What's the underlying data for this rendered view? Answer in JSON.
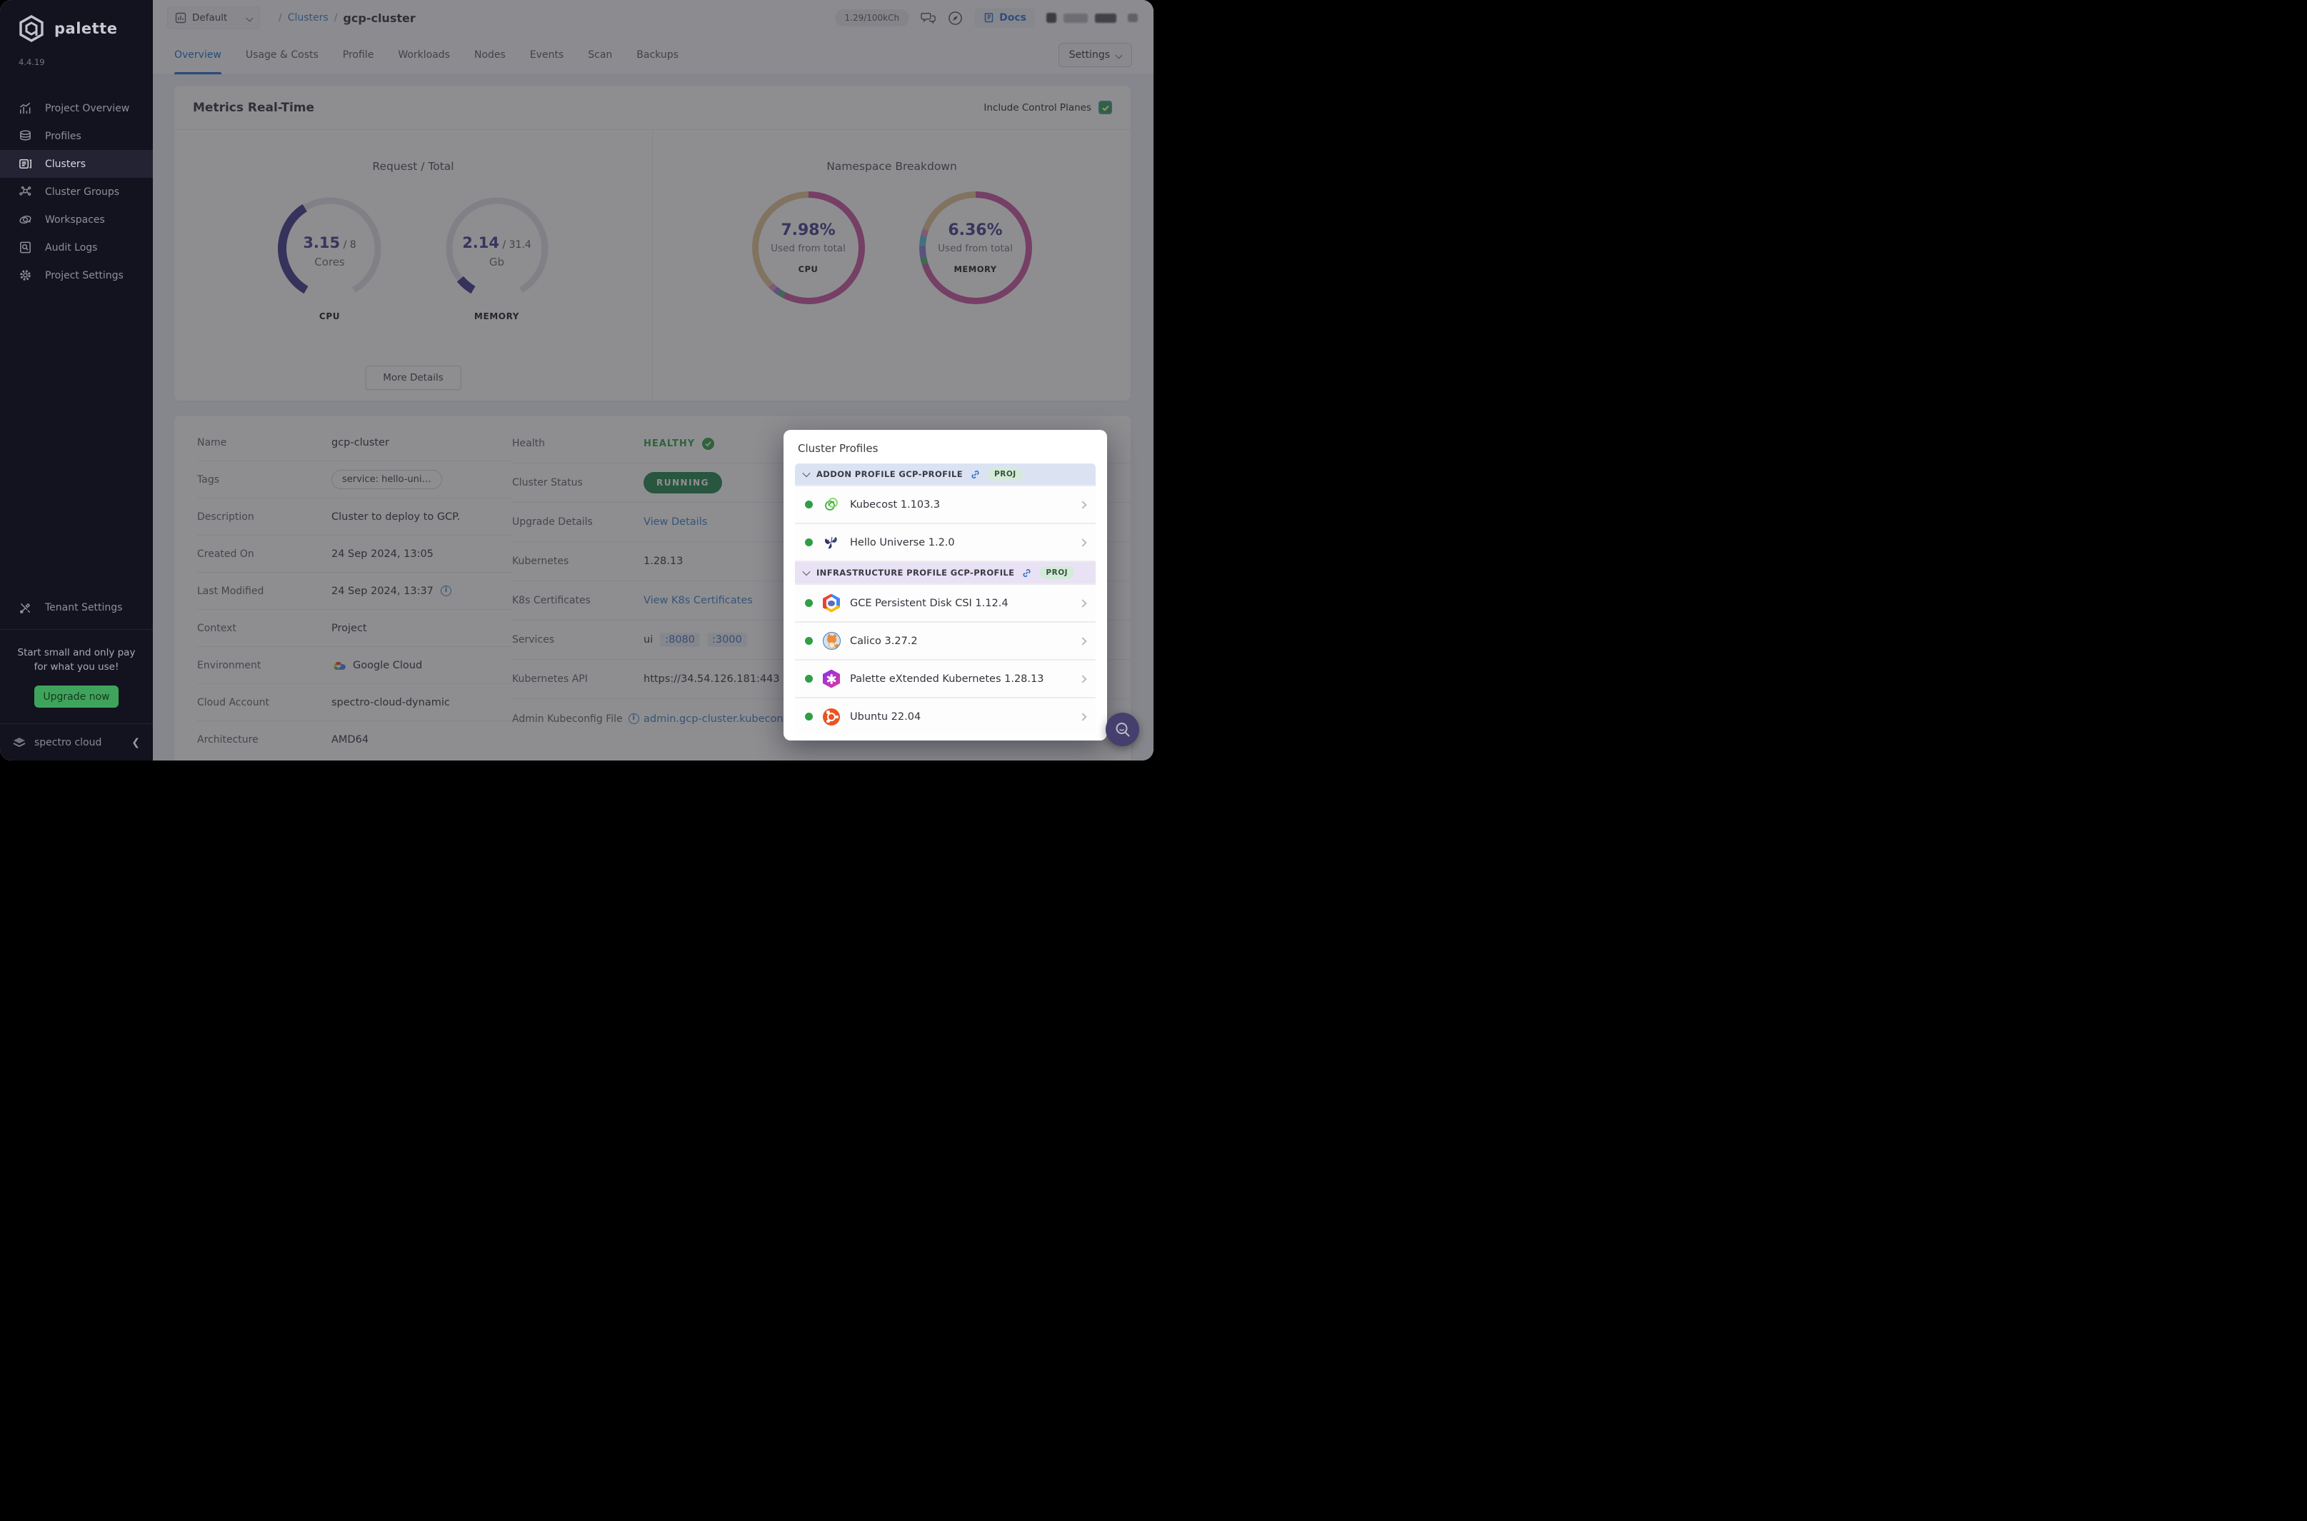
{
  "app": {
    "name": "palette",
    "version": "4.4.19",
    "footer_brand": "spectro cloud"
  },
  "sidebar": {
    "items": [
      {
        "label": "Project Overview"
      },
      {
        "label": "Profiles"
      },
      {
        "label": "Clusters"
      },
      {
        "label": "Cluster Groups"
      },
      {
        "label": "Workspaces"
      },
      {
        "label": "Audit Logs"
      },
      {
        "label": "Project Settings"
      }
    ],
    "tenant_settings": "Tenant Settings",
    "promo_text": "Start small and only pay for what you use!",
    "upgrade_label": "Upgrade now"
  },
  "topbar": {
    "project_selector": "Default",
    "breadcrumb_sep": "/",
    "breadcrumb_link": "Clusters",
    "breadcrumb_current": "gcp-cluster",
    "usage_badge": "1.29/100kCh",
    "docs_label": "Docs"
  },
  "tabs": {
    "items": [
      "Overview",
      "Usage & Costs",
      "Profile",
      "Workloads",
      "Nodes",
      "Events",
      "Scan",
      "Backups"
    ],
    "active": "Overview",
    "settings_label": "Settings"
  },
  "metrics": {
    "title": "Metrics Real-Time",
    "include_toggle_label": "Include Control Planes",
    "include_toggle_checked": true,
    "more_details_label": "More Details",
    "request_total": {
      "title": "Request / Total",
      "gauges": [
        {
          "value": "3.15",
          "total": " / 8",
          "unit": "Cores",
          "label": "CPU",
          "ratio": 0.394,
          "color": "#3a3687"
        },
        {
          "value": "2.14",
          "total": " / 31.4",
          "unit": "Gb",
          "label": "MEMORY",
          "ratio": 0.068,
          "color": "#3a3687"
        }
      ]
    },
    "namespace": {
      "title": "Namespace Breakdown",
      "donuts": [
        {
          "percent": "7.98%",
          "caption": "Used from total",
          "label": "CPU",
          "segments": [
            {
              "color": "#c9519e",
              "pct": 57.5
            },
            {
              "color": "#4daf71",
              "pct": 1.5
            },
            {
              "color": "#8f7bd6",
              "pct": 1.8
            },
            {
              "color": "#d791c6",
              "pct": 1.7
            },
            {
              "color": "#e3c492",
              "pct": 37.5
            }
          ]
        },
        {
          "percent": "6.36%",
          "caption": "Used from total",
          "label": "MEMORY",
          "segments": [
            {
              "color": "#c9519e",
              "pct": 70
            },
            {
              "color": "#4daf71",
              "pct": 2.2
            },
            {
              "color": "#8f7bd6",
              "pct": 3.3
            },
            {
              "color": "#54c2cf",
              "pct": 3
            },
            {
              "color": "#d791c6",
              "pct": 2
            },
            {
              "color": "#e3c492",
              "pct": 19.5
            }
          ]
        }
      ]
    }
  },
  "chart_data": [
    {
      "type": "gauge",
      "title": "Request / Total CPU",
      "value": 3.15,
      "max": 8,
      "unit": "Cores"
    },
    {
      "type": "gauge",
      "title": "Request / Total Memory",
      "value": 2.14,
      "max": 31.4,
      "unit": "Gb"
    },
    {
      "type": "pie",
      "title": "Namespace Breakdown CPU",
      "values": [
        7.98
      ],
      "annotations": [
        "7.98% Used from total CPU"
      ]
    },
    {
      "type": "pie",
      "title": "Namespace Breakdown Memory",
      "values": [
        6.36
      ],
      "annotations": [
        "6.36% Used from total MEMORY"
      ]
    }
  ],
  "details": {
    "left": [
      {
        "label": "Name",
        "value": "gcp-cluster"
      },
      {
        "label": "Tags",
        "value": "service: hello-uni…"
      },
      {
        "label": "Description",
        "value": "Cluster to deploy to GCP."
      },
      {
        "label": "Created On",
        "value": "24 Sep 2024, 13:05"
      },
      {
        "label": "Last Modified",
        "value": "24 Sep 2024, 13:37"
      },
      {
        "label": "Context",
        "value": "Project"
      },
      {
        "label": "Environment",
        "value": "Google Cloud"
      },
      {
        "label": "Cloud Account",
        "value": "spectro-cloud-dynamic"
      },
      {
        "label": "Architecture",
        "value": "AMD64"
      }
    ],
    "right": [
      {
        "label": "Health",
        "value": "HEALTHY"
      },
      {
        "label": "Cluster Status",
        "value": "RUNNING"
      },
      {
        "label": "Upgrade Details",
        "value": "View Details"
      },
      {
        "label": "Kubernetes",
        "value": "1.28.13"
      },
      {
        "label": "K8s Certificates",
        "value": "View K8s Certificates"
      },
      {
        "label": "Services",
        "value": "ui",
        "chips": [
          ":8080",
          ":3000"
        ]
      },
      {
        "label": "Kubernetes API",
        "value": "https://34.54.126.181:443"
      },
      {
        "label": "Admin Kubeconfig File",
        "value": "admin.gcp-cluster.kubeconfig"
      }
    ]
  },
  "popup": {
    "title": "Cluster Profiles",
    "badge": "PROJ",
    "sections": [
      {
        "name": "ADDON PROFILE GCP-PROFILE",
        "items": [
          {
            "name": "Kubecost 1.103.3"
          },
          {
            "name": "Hello Universe 1.2.0"
          }
        ]
      },
      {
        "name": "INFRASTRUCTURE PROFILE GCP-PROFILE",
        "items": [
          {
            "name": "GCE Persistent Disk CSI 1.12.4"
          },
          {
            "name": "Calico 3.27.2"
          },
          {
            "name": "Palette eXtended Kubernetes 1.28.13"
          },
          {
            "name": "Ubuntu 22.04"
          }
        ]
      }
    ]
  },
  "colors": {
    "accent_blue": "#1b6ac9",
    "gauge_indigo": "#3a3687",
    "healthy_green": "#2f9e44",
    "status_green": "#1e8449",
    "upgrade_green": "#3fa45b"
  }
}
